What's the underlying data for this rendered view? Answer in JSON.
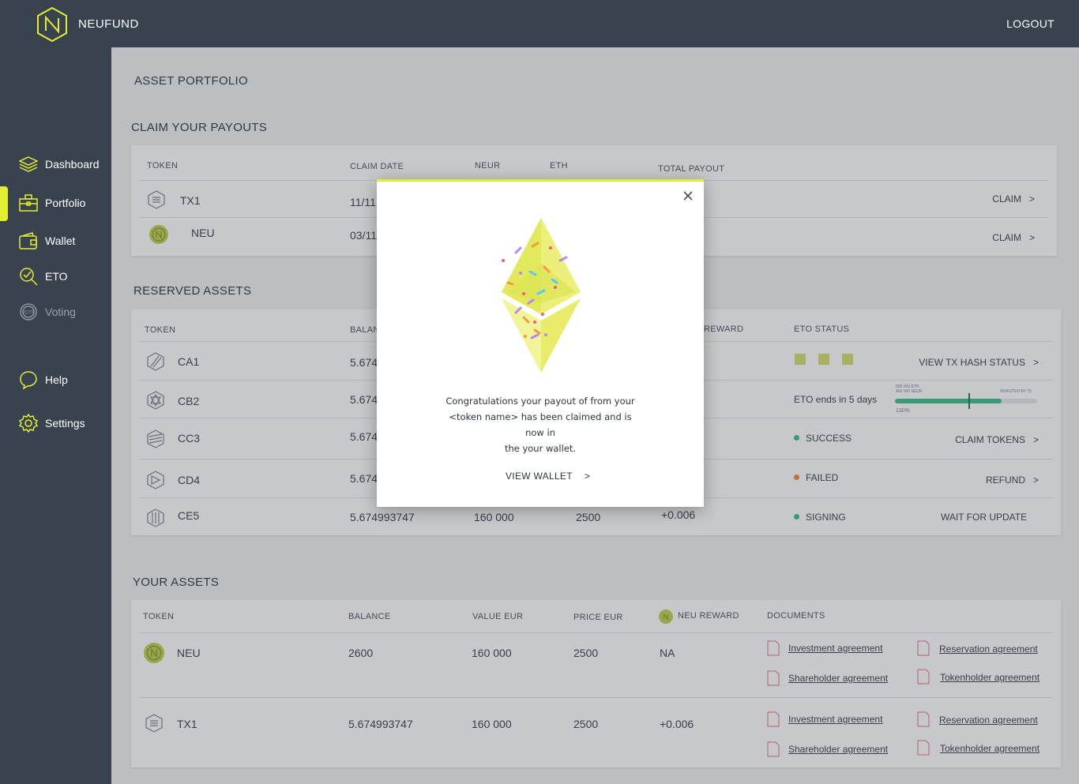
{
  "app": {
    "brand": "NEUFUND",
    "logout": "LOGOUT"
  },
  "sidebar": {
    "items": [
      {
        "label": "Dashboard",
        "icon": "layers-icon"
      },
      {
        "label": "Portfolio",
        "icon": "briefcase-icon",
        "active": true
      },
      {
        "label": "Wallet",
        "icon": "wallet-icon"
      },
      {
        "label": "ETO",
        "icon": "magnifier-check-icon"
      },
      {
        "label": "Voting",
        "icon": "vote-icon",
        "disabled": true
      },
      {
        "label": "Help",
        "icon": "chat-icon"
      },
      {
        "label": "Settings",
        "icon": "gear-icon"
      }
    ]
  },
  "page": {
    "title": "ASSET PORTFOLIO"
  },
  "payouts": {
    "title": "CLAIM YOUR PAYOUTS",
    "headers": {
      "token": "TOKEN",
      "claim_date": "CLAIM DATE",
      "neur": "NEUR",
      "eth": "ETH",
      "total": "TOTAL PAYOUT"
    },
    "rows": [
      {
        "token": "TX1",
        "date": "11/11",
        "action": "CLAIM"
      },
      {
        "token": "NEU",
        "date": "03/11",
        "action": "CLAIM"
      }
    ]
  },
  "reserved": {
    "title": "RESERVED ASSETS",
    "headers": {
      "token": "TOKEN",
      "balance": "BALAN",
      "reward": "REWARD",
      "status": "ETO STATUS"
    },
    "rows": [
      {
        "token": "CA1",
        "balance": "5.674",
        "status": "",
        "action": "VIEW TX HASH STATUS"
      },
      {
        "token": "CB2",
        "balance": "5.674",
        "status": "ETO ends in 5 days",
        "action": ""
      },
      {
        "token": "CC3",
        "balance": "5.674",
        "status": "SUCCESS",
        "action": "CLAIM TOKENS"
      },
      {
        "token": "CD4",
        "balance": "5.674",
        "status": "FAILED",
        "action": "REFUND"
      },
      {
        "token": "CE5",
        "balance": "5.674993747",
        "value": "160 000",
        "price": "2500",
        "reward": "+0.006",
        "status": "SIGNING",
        "action": "WAIT FOR UPDATE"
      }
    ],
    "progress": {
      "left_top": "800 000 ETH",
      "left_bottom": "400 000 NEUR",
      "right": "INVESTED BY 75",
      "pct": "130%",
      "fill": 0.75
    }
  },
  "assets": {
    "title": "YOUR ASSETS",
    "headers": {
      "token": "TOKEN",
      "balance": "BALANCE",
      "value": "VALUE EUR",
      "price": "PRICE EUR",
      "reward": "NEU REWARD",
      "documents": "DOCUMENTS"
    },
    "rows": [
      {
        "token": "NEU",
        "balance": "2600",
        "value": "160 000",
        "price": "2500",
        "reward": "NA"
      },
      {
        "token": "TX1",
        "balance": "5.674993747",
        "value": "160 000",
        "price": "2500",
        "reward": "+0.006"
      }
    ],
    "docs": {
      "investment": "Investment agreement",
      "reservation": "Reservation agreement",
      "shareholder": "Shareholder agreement",
      "tokenholder": "Tokenholder agreement"
    }
  },
  "modal": {
    "line1": "Congratulations your payout of  from your",
    "line2": "<token name> has been claimed and is now in",
    "line3": "the  your wallet.",
    "button": "VIEW WALLET"
  },
  "colors": {
    "accent": "#e2ee34",
    "sidebar": "#38434f",
    "success": "#3fbf8a",
    "failed": "#f28b3a",
    "signing": "#3fbf8a"
  }
}
